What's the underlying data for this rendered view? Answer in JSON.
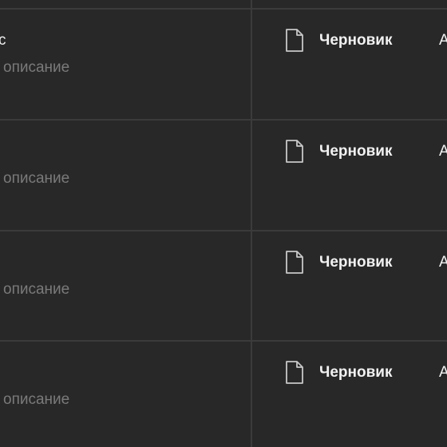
{
  "rows": [
    {
      "title": "c",
      "description": "описание",
      "status": "Черновик",
      "next_column_partial": "А",
      "status_icon": "draft-document-icon"
    },
    {
      "title": "",
      "description": "описание",
      "status": "Черновик",
      "next_column_partial": "А",
      "status_icon": "draft-document-icon"
    },
    {
      "title": "",
      "description": "описание",
      "status": "Черновик",
      "next_column_partial": "А",
      "status_icon": "draft-document-icon"
    },
    {
      "title": "",
      "description": "описание",
      "status": "Черновик",
      "next_column_partial": "А",
      "status_icon": "draft-document-icon"
    }
  ],
  "colors": {
    "background": "#282828",
    "divider": "#3b3b3b",
    "text_primary": "#f1f1f1",
    "text_secondary": "#7a7a7a"
  }
}
